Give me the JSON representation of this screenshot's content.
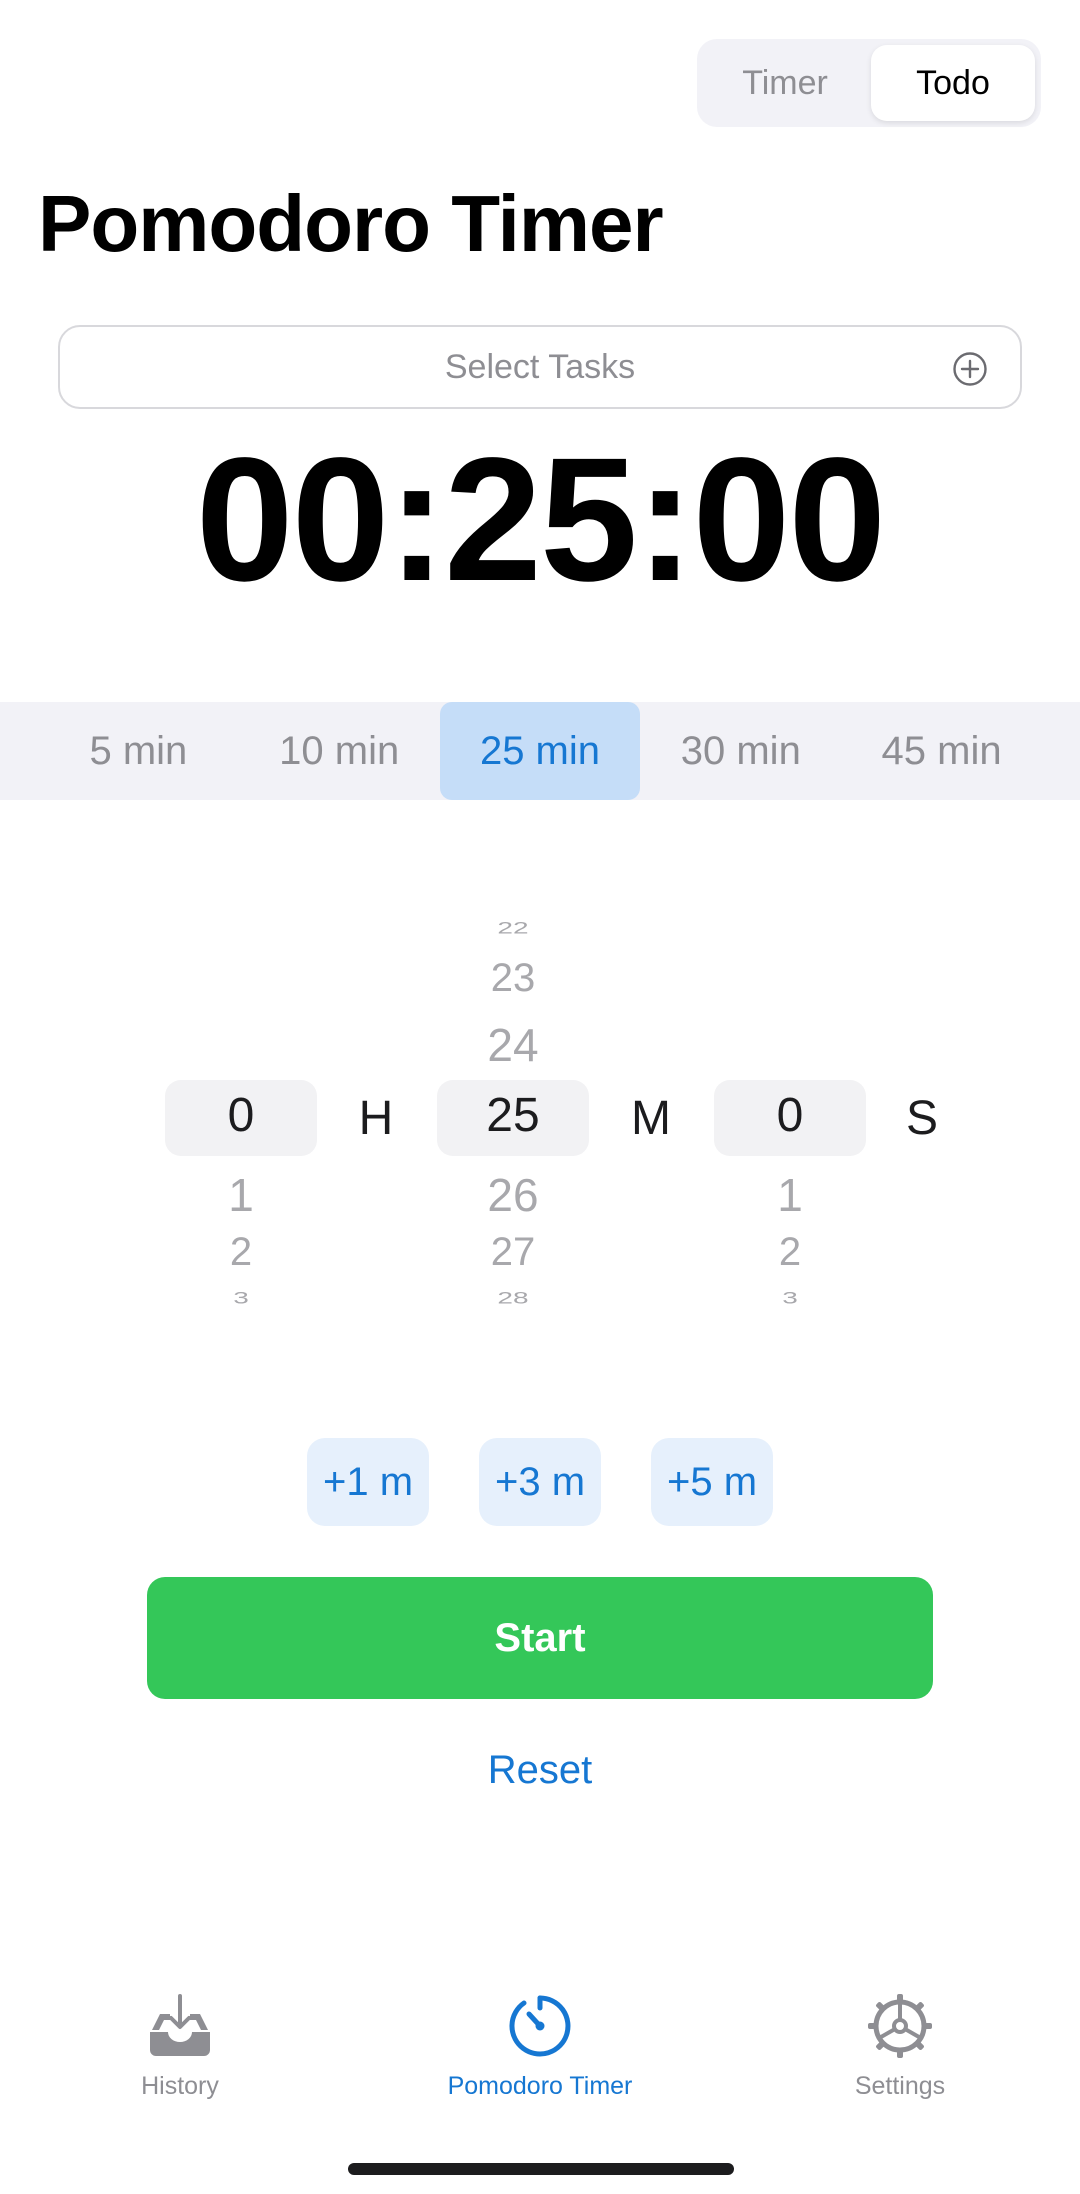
{
  "segmented": {
    "options": [
      "Timer",
      "Todo"
    ],
    "selected": "Todo"
  },
  "header": {
    "title": "Pomodoro Timer"
  },
  "task_select": {
    "label": "Select Tasks"
  },
  "timer": {
    "display": "00:25:00"
  },
  "presets": {
    "items": [
      "5 min",
      "10 min",
      "25 min",
      "30 min",
      "45 min"
    ],
    "selected": "25 min"
  },
  "picker": {
    "hours": {
      "above": [
        "",
        "",
        ""
      ],
      "selected": "0",
      "below": [
        "1",
        "2",
        "3"
      ],
      "unit": "H"
    },
    "minutes": {
      "above": [
        "22",
        "23",
        "24"
      ],
      "selected": "25",
      "below": [
        "26",
        "27",
        "28"
      ],
      "unit": "M"
    },
    "seconds": {
      "above": [
        "",
        "",
        ""
      ],
      "selected": "0",
      "below": [
        "1",
        "2",
        "3"
      ],
      "unit": "S"
    }
  },
  "quick_add": [
    "+1 m",
    "+3 m",
    "+5 m"
  ],
  "actions": {
    "start": "Start",
    "reset": "Reset"
  },
  "tabbar": {
    "items": [
      {
        "label": "History",
        "icon": "tray-download-icon"
      },
      {
        "label": "Pomodoro Timer",
        "icon": "timer-icon"
      },
      {
        "label": "Settings",
        "icon": "gear-icon"
      }
    ],
    "active": "Pomodoro Timer"
  },
  "colors": {
    "accent": "#1677d2",
    "start": "#34c759",
    "preset_active_bg": "#c5ddf8",
    "inactive": "#8e8e93"
  }
}
